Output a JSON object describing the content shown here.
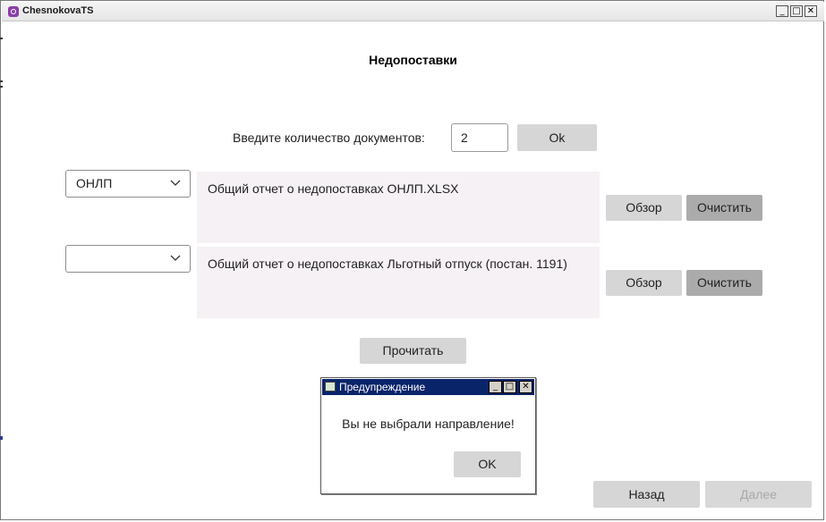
{
  "window": {
    "title": "ChesnokovaTS",
    "minimize": "_",
    "maximize": "□",
    "close": "✕"
  },
  "page": {
    "title": "Недопоставки"
  },
  "doc_count": {
    "label": "Введите количество документов:",
    "value": "2",
    "ok_label": "Ok"
  },
  "rows": [
    {
      "direction": "ОНЛП",
      "file": "Общий отчет о недопоставках ОНЛП.XLSX",
      "browse_label": "Обзор",
      "clear_label": "Очистить"
    },
    {
      "direction": "",
      "file": "Общий отчет о недопоставках Льготный отпуск  (постан. 1191)",
      "browse_label": "Обзор",
      "clear_label": "Очистить"
    }
  ],
  "read_button": "Прочитать",
  "dialog": {
    "title": "Предупреждение",
    "message": "Вы не выбрали направление!",
    "ok_label": "OK",
    "minimize": "_",
    "maximize": "□",
    "close": "✕"
  },
  "nav": {
    "back_label": "Назад",
    "next_label": "Далее"
  }
}
